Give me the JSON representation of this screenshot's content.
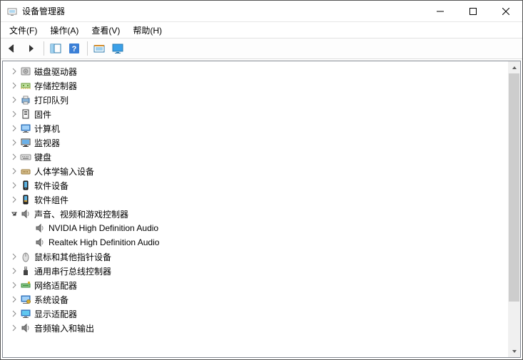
{
  "titlebar": {
    "title": "设备管理器"
  },
  "menu": {
    "file": "文件(F)",
    "action": "操作(A)",
    "view": "查看(V)",
    "help": "帮助(H)"
  },
  "tree": {
    "items": [
      {
        "label": "磁盘驱动器",
        "icon": "disk-drive",
        "level": 1,
        "expanded": false,
        "hasChildren": true
      },
      {
        "label": "存储控制器",
        "icon": "storage-controller",
        "level": 1,
        "expanded": false,
        "hasChildren": true
      },
      {
        "label": "打印队列",
        "icon": "printer",
        "level": 1,
        "expanded": false,
        "hasChildren": true
      },
      {
        "label": "固件",
        "icon": "firmware",
        "level": 1,
        "expanded": false,
        "hasChildren": true
      },
      {
        "label": "计算机",
        "icon": "computer",
        "level": 1,
        "expanded": false,
        "hasChildren": true
      },
      {
        "label": "监视器",
        "icon": "monitor",
        "level": 1,
        "expanded": false,
        "hasChildren": true
      },
      {
        "label": "键盘",
        "icon": "keyboard",
        "level": 1,
        "expanded": false,
        "hasChildren": true
      },
      {
        "label": "人体学输入设备",
        "icon": "hid",
        "level": 1,
        "expanded": false,
        "hasChildren": true
      },
      {
        "label": "软件设备",
        "icon": "software-device",
        "level": 1,
        "expanded": false,
        "hasChildren": true
      },
      {
        "label": "软件组件",
        "icon": "software-component",
        "level": 1,
        "expanded": false,
        "hasChildren": true
      },
      {
        "label": "声音、视频和游戏控制器",
        "icon": "sound",
        "level": 1,
        "expanded": true,
        "hasChildren": true
      },
      {
        "label": "NVIDIA High Definition Audio",
        "icon": "sound",
        "level": 2,
        "expanded": false,
        "hasChildren": false
      },
      {
        "label": "Realtek High Definition Audio",
        "icon": "sound",
        "level": 2,
        "expanded": false,
        "hasChildren": false
      },
      {
        "label": "鼠标和其他指针设备",
        "icon": "mouse",
        "level": 1,
        "expanded": false,
        "hasChildren": true
      },
      {
        "label": "通用串行总线控制器",
        "icon": "usb",
        "level": 1,
        "expanded": false,
        "hasChildren": true
      },
      {
        "label": "网络适配器",
        "icon": "network",
        "level": 1,
        "expanded": false,
        "hasChildren": true
      },
      {
        "label": "系统设备",
        "icon": "system",
        "level": 1,
        "expanded": false,
        "hasChildren": true
      },
      {
        "label": "显示适配器",
        "icon": "display",
        "level": 1,
        "expanded": false,
        "hasChildren": true
      },
      {
        "label": "音频输入和输出",
        "icon": "audio-io",
        "level": 1,
        "expanded": false,
        "hasChildren": true
      }
    ]
  }
}
